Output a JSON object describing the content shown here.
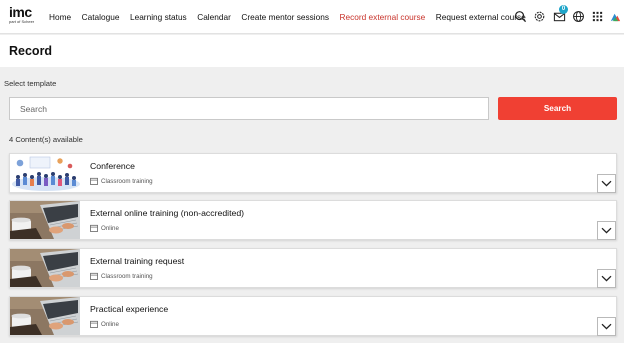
{
  "brand": {
    "logo_text": "imc",
    "logo_sub": "part of Scheer"
  },
  "nav": [
    {
      "label": "Home",
      "active": false
    },
    {
      "label": "Catalogue",
      "active": false
    },
    {
      "label": "Learning status",
      "active": false
    },
    {
      "label": "Calendar",
      "active": false
    },
    {
      "label": "Create mentor sessions",
      "active": false
    },
    {
      "label": "Record external course",
      "active": true
    },
    {
      "label": "Request external course",
      "active": false
    }
  ],
  "toolbar": {
    "icons": [
      "search-icon",
      "settings-icon",
      "mail-icon",
      "globe-icon",
      "apps-grid-icon",
      "user-avatar-icon"
    ],
    "mail_badge": "0"
  },
  "page": {
    "title": "Record"
  },
  "template": {
    "label": "Select template",
    "search_placeholder": "Search",
    "search_button": "Search",
    "count_text": "4 Content(s) available"
  },
  "cards": [
    {
      "title": "Conference",
      "type": "Classroom training",
      "thumb": "conference-illustration"
    },
    {
      "title": "External online training (non-accredited)",
      "type": "Online",
      "thumb": "laptop-photo"
    },
    {
      "title": "External training request",
      "type": "Classroom training",
      "thumb": "laptop-photo"
    },
    {
      "title": "Practical experience",
      "type": "Online",
      "thumb": "laptop-photo"
    }
  ],
  "colors": {
    "accent": "#f04033",
    "active_nav": "#c8332b",
    "badge": "#1fa5c9"
  }
}
